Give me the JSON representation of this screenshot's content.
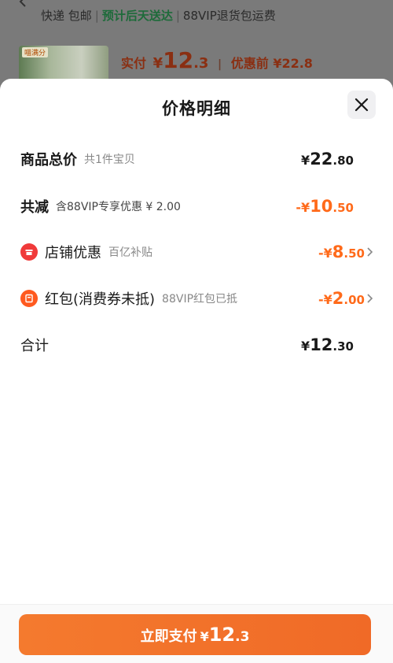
{
  "background": {
    "shipping_label": "快递 包邮",
    "delivery_estimate": "预计后天送达",
    "return_shipping": "88VIP退货包运费",
    "product_tag": "喵满分",
    "paid_label": "实付",
    "paid_currency": "¥",
    "paid_int": "12",
    "paid_dec": ".3",
    "divider": "|",
    "before_discount": "优惠前 ¥22.8"
  },
  "sheet": {
    "title": "价格明细"
  },
  "rows": {
    "total": {
      "label": "商品总价",
      "sub": "共1件宝贝",
      "currency": "¥",
      "int": "22",
      "dec": ".80"
    },
    "reduce": {
      "label": "共减",
      "sub": "含88VIP专享优惠 ¥ 2.00",
      "currency": "-¥",
      "int": "10",
      "dec": ".50"
    },
    "store": {
      "label": "店铺优惠",
      "sub": "百亿补贴",
      "currency": "-¥",
      "int": "8",
      "dec": ".50"
    },
    "redpacket": {
      "label": "红包(消费券未抵)",
      "sub": "88VIP红包已抵",
      "currency": "-¥",
      "int": "2",
      "dec": ".00"
    },
    "subtotal": {
      "label": "合计",
      "currency": "¥",
      "int": "12",
      "dec": ".30"
    }
  },
  "footer": {
    "pay_label": "立即支付",
    "currency": "¥",
    "int": "12",
    "dec": ".3"
  },
  "colors": {
    "accent": "#ff6a1a",
    "button": "#f47a2e",
    "store_icon": "#f03a3a",
    "coupon_icon": "#ff5a1f"
  },
  "icons": {
    "close": "close-icon",
    "store": "store-icon",
    "coupon": "coupon-icon",
    "chevron": "chevron-right-icon"
  }
}
